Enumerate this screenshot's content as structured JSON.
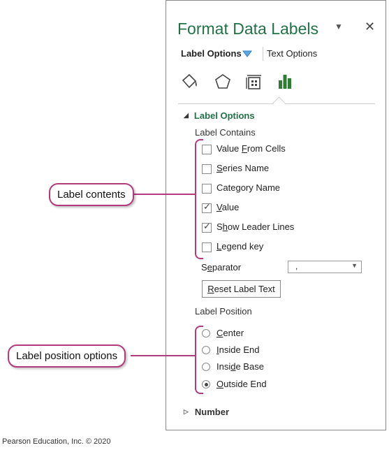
{
  "pane": {
    "title": "Format Data Labels",
    "menu_glyph": "▼",
    "close_glyph": "✕",
    "tabs": {
      "label_options": "Label Options",
      "text_options": "Text Options"
    },
    "icons": [
      "fill-line-icon",
      "effects-icon",
      "size-properties-icon",
      "label-options-icon"
    ]
  },
  "label_options": {
    "heading": "Label Options",
    "label_contains": "Label Contains",
    "checkboxes": [
      {
        "pre": "Value ",
        "key": "F",
        "post": "rom Cells",
        "checked": false
      },
      {
        "pre": "",
        "key": "S",
        "post": "eries Name",
        "checked": false
      },
      {
        "pre": "Category Name",
        "key": "",
        "post": "",
        "checked": false
      },
      {
        "pre": "",
        "key": "V",
        "post": "alue",
        "checked": true
      },
      {
        "pre": "S",
        "key": "h",
        "post": "ow Leader Lines",
        "checked": true
      },
      {
        "pre": "",
        "key": "L",
        "post": "egend key",
        "checked": false
      }
    ],
    "separator": {
      "pre": "S",
      "key": "e",
      "post": "parator",
      "value": ","
    },
    "reset_button": {
      "pre": "",
      "key": "R",
      "post": "eset Label Text"
    },
    "label_position": "Label Position",
    "radios": [
      {
        "pre": "",
        "key": "C",
        "post": "enter",
        "selected": false
      },
      {
        "pre": "",
        "key": "I",
        "post": "nside End",
        "selected": false
      },
      {
        "pre": "Insi",
        "key": "d",
        "post": "e Base",
        "selected": false
      },
      {
        "pre": "",
        "key": "O",
        "post": "utside End",
        "selected": true
      }
    ]
  },
  "number_section": "Number",
  "callouts": {
    "contents": "Label contents",
    "position": "Label position options"
  },
  "credit": "Pearson Education, Inc. © 2020",
  "colors": {
    "accent": "#217346",
    "callout": "#b13b7b",
    "highlight_icon": "#2e7d32"
  }
}
